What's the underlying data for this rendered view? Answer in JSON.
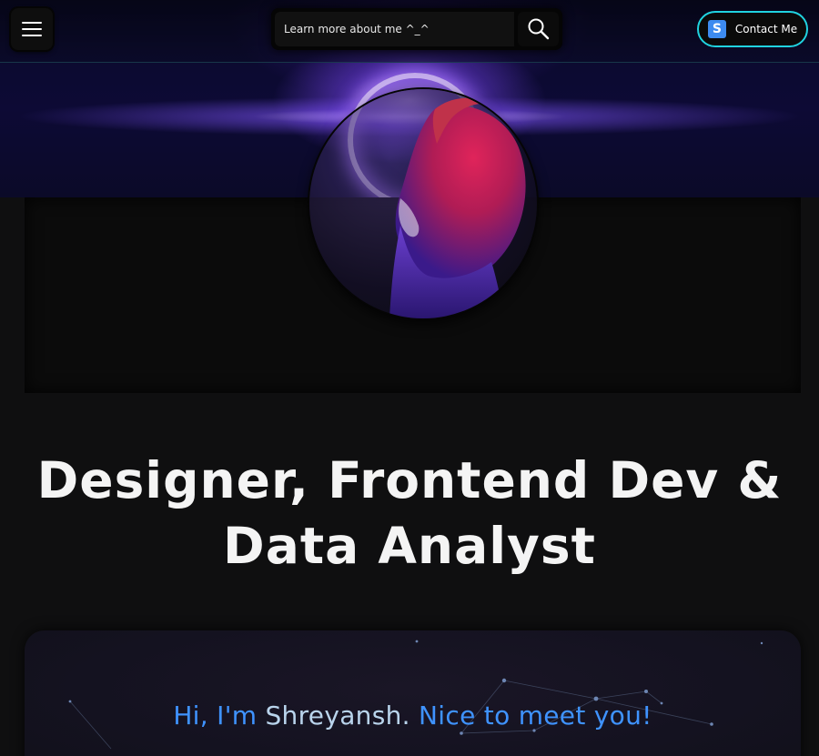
{
  "nav": {
    "search_placeholder": "Learn more about me ^_^",
    "contact_label": "Contact Me",
    "contact_logo_letter": "S"
  },
  "headline": {
    "line1": "Designer, Frontend Dev &",
    "line2": "Data Analyst"
  },
  "intro": {
    "greeting": "Hi, I'm",
    "name": "Shreyansh.",
    "tail": "Nice to meet you!"
  },
  "colors": {
    "accent_blue": "#3f93ff",
    "contact_border": "#20d3e0",
    "background": "#0f0f10"
  },
  "icons": {
    "menu": "hamburger-icon",
    "search": "search-icon",
    "contact_logo": "brand-logo-icon"
  }
}
